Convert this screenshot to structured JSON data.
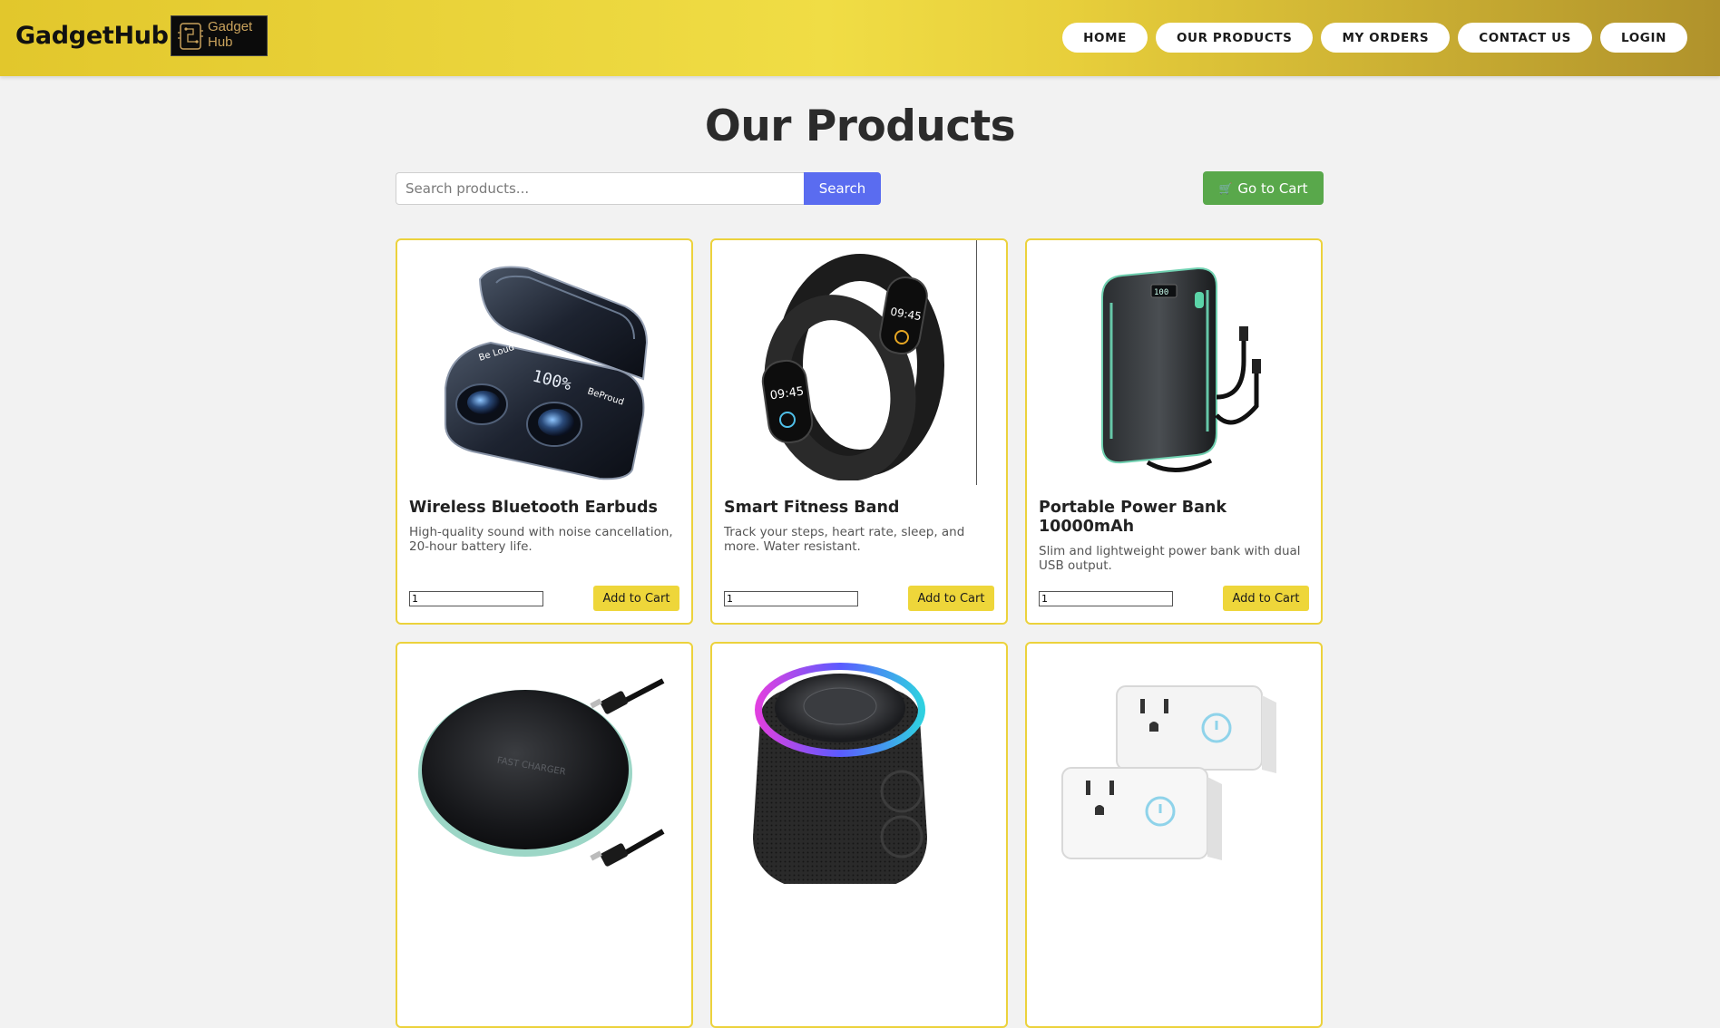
{
  "header": {
    "brand": "GadgetHub",
    "logo_text": [
      "Gadget",
      "Hub"
    ],
    "nav": [
      "HOME",
      "OUR PRODUCTS",
      "MY ORDERS",
      "CONTACT US",
      "LOGIN"
    ]
  },
  "main": {
    "title": "Our Products",
    "search_placeholder": "Search products...",
    "search_button": "Search",
    "cart_button": "Go to Cart",
    "cart_icon": "cart-icon"
  },
  "products": [
    {
      "name": "Wireless Bluetooth Earbuds",
      "desc": "High-quality sound with noise cancellation, 20-hour battery life.",
      "qty": "1",
      "button": "Add to Cart",
      "image": "earbuds-image"
    },
    {
      "name": "Smart Fitness Band",
      "desc": "Track your steps, heart rate, sleep, and more. Water resistant.",
      "qty": "1",
      "button": "Add to Cart",
      "image": "fitness-band-image"
    },
    {
      "name": "Portable Power Bank 10000mAh",
      "desc": "Slim and lightweight power bank with dual USB output.",
      "qty": "1",
      "button": "Add to Cart",
      "image": "power-bank-image"
    },
    {
      "image": "wireless-charger-image"
    },
    {
      "image": "bluetooth-speaker-image"
    },
    {
      "image": "smart-plug-image"
    }
  ],
  "colors": {
    "accent": "#eed63a",
    "search": "#5a6cf0",
    "cart": "#59a84b"
  }
}
